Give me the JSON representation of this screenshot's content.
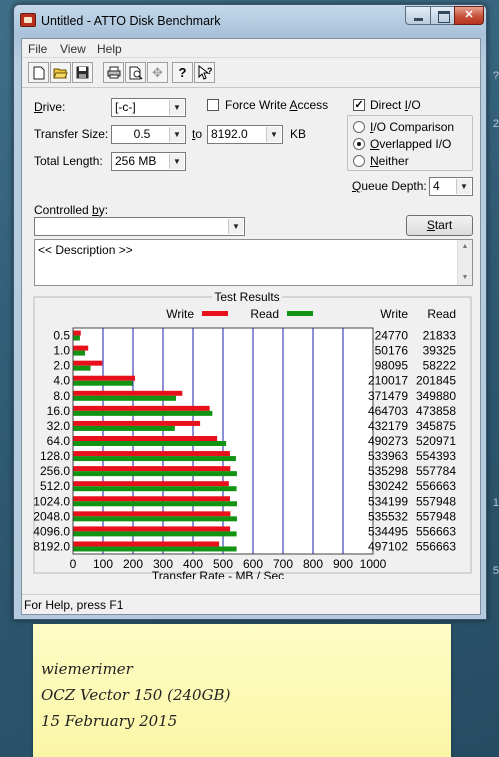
{
  "window": {
    "title": "Untitled - ATTO Disk Benchmark"
  },
  "menu": [
    "File",
    "View",
    "Help"
  ],
  "toolbar": [
    "new-icon",
    "open-icon",
    "save-icon",
    "print-icon",
    "print-preview-icon",
    "move-icon",
    "help-icon",
    "context-help-icon"
  ],
  "form": {
    "drive_label": "Drive:",
    "drive_value": "[-c-]",
    "transfer_size_label": "Transfer Size:",
    "transfer_from": "0.5",
    "to_label": "to",
    "transfer_to": "8192.0",
    "kb_label": "KB",
    "total_length_label": "Total Length:",
    "total_length_value": "256 MB",
    "force_write_label": "Force Write Access",
    "force_write_checked": false,
    "direct_io_label": "Direct I/O",
    "direct_io_checked": true,
    "io_options": [
      "I/O Comparison",
      "Overlapped I/O",
      "Neither"
    ],
    "io_selected": 1,
    "queue_depth_label": "Queue Depth:",
    "queue_depth_value": "4",
    "controlled_by_label": "Controlled by:",
    "controlled_by_value": "",
    "start_label": "Start",
    "description": "<< Description >>"
  },
  "results": {
    "title": "Test Results",
    "write_legend": "Write",
    "read_legend": "Read",
    "write_header": "Write",
    "read_header": "Read",
    "write_color": "#e8101a",
    "read_color": "#129412",
    "grid_color": "#1e1ea8"
  },
  "chart_data": {
    "type": "bar",
    "orientation": "horizontal",
    "categories": [
      "0.5",
      "1.0",
      "2.0",
      "4.0",
      "8.0",
      "16.0",
      "32.0",
      "64.0",
      "128.0",
      "256.0",
      "512.0",
      "1024.0",
      "2048.0",
      "4096.0",
      "8192.0"
    ],
    "series": [
      {
        "name": "Write",
        "values": [
          24770,
          50176,
          98095,
          210017,
          371479,
          464703,
          432179,
          490273,
          533963,
          535298,
          530242,
          534199,
          535532,
          534495,
          497102
        ]
      },
      {
        "name": "Read",
        "values": [
          21833,
          39325,
          58222,
          201845,
          349880,
          473858,
          345875,
          520971,
          554393,
          557784,
          556663,
          557948,
          557948,
          556663,
          556663
        ]
      }
    ],
    "xlabel": "Transfer Rate - MB / Sec",
    "xticks": [
      "0",
      "100",
      "200",
      "300",
      "400",
      "500",
      "600",
      "700",
      "800",
      "900",
      "1000"
    ],
    "xlim": [
      0,
      1000
    ],
    "grid": true,
    "legend": "top"
  },
  "status": "For Help, press F1",
  "note": {
    "lines": [
      "wiemerimer",
      "OCZ Vector 150 (240GB)",
      "15 February 2015"
    ]
  },
  "background_fragments": [
    "?",
    "2",
    "1",
    "5"
  ]
}
